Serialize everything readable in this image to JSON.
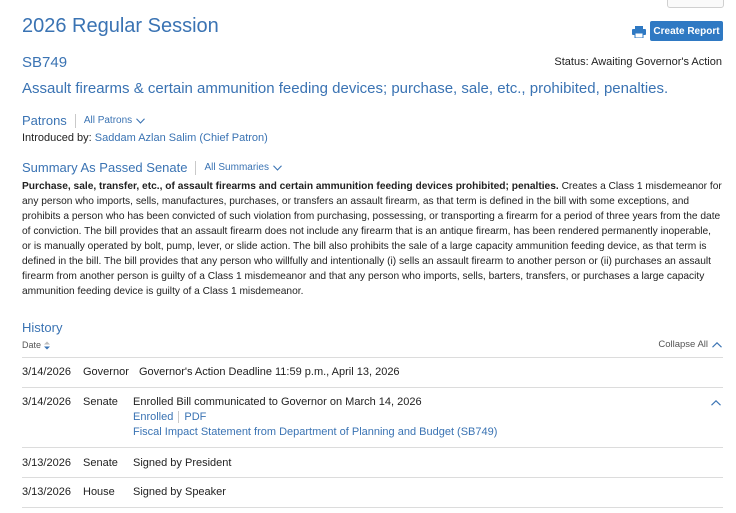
{
  "header": {
    "session_title": "2026 Regular Session",
    "create_report_label": "Create Report"
  },
  "bill": {
    "id": "SB749",
    "status": "Status: Awaiting Governor's Action",
    "title": "Assault firearms & certain ammunition feeding devices; purchase, sale, etc., prohibited, penalties."
  },
  "patrons": {
    "heading": "Patrons",
    "dropdown_label": "All Patrons",
    "introduced_label": "Introduced by:",
    "introduced_by": "Saddam Azlan Salim (Chief Patron)"
  },
  "summary": {
    "heading": "Summary As Passed Senate",
    "dropdown_label": "All Summaries",
    "lead": "Purchase, sale, transfer, etc., of assault firearms and certain ammunition feeding devices prohibited; penalties.",
    "body": "Creates a Class 1 misdemeanor for any person who imports, sells, manufactures, purchases, or transfers an assault firearm, as that term is defined in the bill with some exceptions, and prohibits a person who has been convicted of such violation from purchasing, possessing, or transporting a firearm for a period of three years from the date of conviction. The bill provides that an assault firearm does not include any firearm that is an antique firearm, has been rendered permanently inoperable, or is manually operated by bolt, pump, lever, or slide action. The bill also prohibits the sale of a large capacity ammunition feeding device, as that term is defined in the bill. The bill provides that any person who willfully and intentionally (i) sells an assault firearm to another person or (ii) purchases an assault firearm from another person is guilty of a Class 1 misdemeanor and that any person who imports, sells, barters, transfers, or purchases a large capacity ammunition feeding device is guilty of a Class 1 misdemeanor."
  },
  "history": {
    "heading": "History",
    "date_column": "Date",
    "collapse_all_label": "Collapse All",
    "rows": [
      {
        "date": "3/14/2026",
        "chamber": "Governor",
        "action": "Governor's Action Deadline 11:59 p.m., April 13, 2026"
      },
      {
        "date": "3/14/2026",
        "chamber": "Senate",
        "action": "Enrolled Bill communicated to Governor on March 14, 2026",
        "links": [
          "Enrolled",
          "PDF"
        ],
        "fiscal_link": "Fiscal Impact Statement from Department of Planning and Budget (SB749)"
      },
      {
        "date": "3/13/2026",
        "chamber": "Senate",
        "action": "Signed by President"
      },
      {
        "date": "3/13/2026",
        "chamber": "House",
        "action": "Signed by Speaker"
      }
    ]
  },
  "colors": {
    "link_blue": "#3a73b3",
    "button_blue": "#2f79c3"
  }
}
